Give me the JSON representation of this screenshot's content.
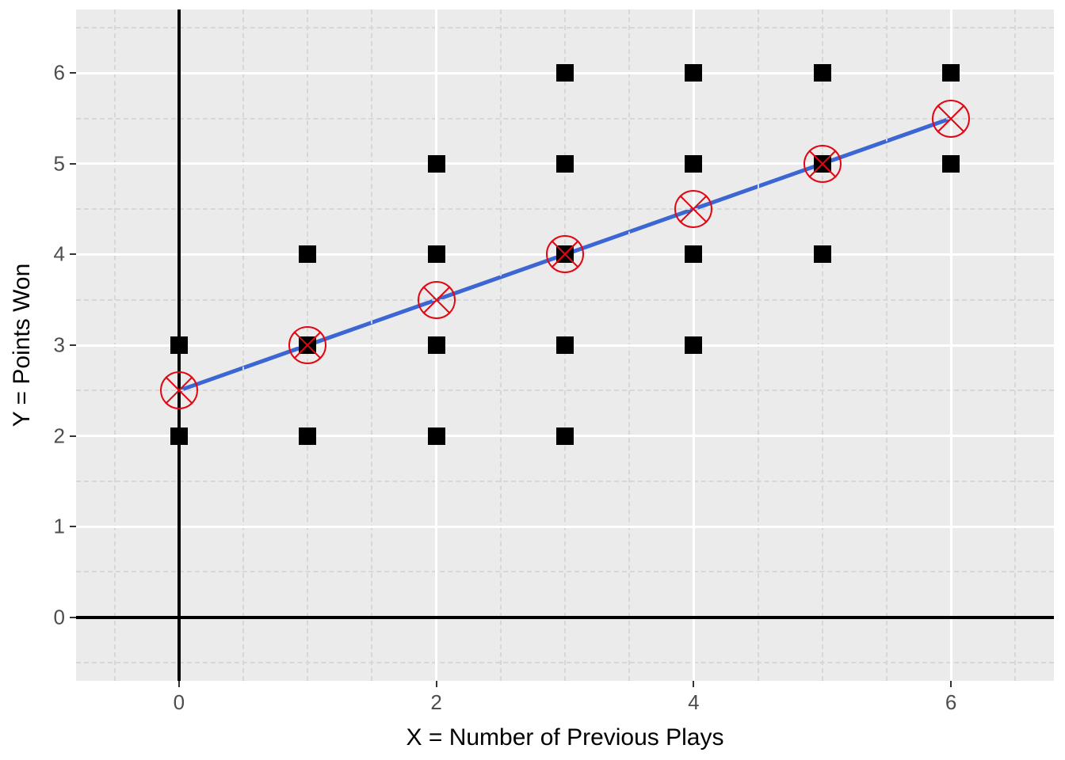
{
  "chart_data": {
    "type": "scatter",
    "xlabel": "X = Number of Previous Plays",
    "ylabel": "Y = Points Won",
    "xlim": [
      -0.8,
      6.8
    ],
    "ylim": [
      -0.7,
      6.7
    ],
    "x_ticks": [
      0,
      2,
      4,
      6
    ],
    "y_ticks": [
      0,
      1,
      2,
      3,
      4,
      5,
      6
    ],
    "x_minor": [
      -0.5,
      0.5,
      1,
      1.5,
      2.5,
      3,
      3.5,
      4.5,
      5,
      5.5,
      6.5
    ],
    "y_minor": [
      -0.5,
      0.5,
      1.5,
      2.5,
      3.5,
      4.5,
      5.5,
      6.5
    ],
    "series": [
      {
        "name": "data-points",
        "marker": "black-square",
        "points": [
          {
            "x": 0,
            "y": 2
          },
          {
            "x": 0,
            "y": 3
          },
          {
            "x": 1,
            "y": 2
          },
          {
            "x": 1,
            "y": 3
          },
          {
            "x": 1,
            "y": 4
          },
          {
            "x": 2,
            "y": 2
          },
          {
            "x": 2,
            "y": 3
          },
          {
            "x": 2,
            "y": 4
          },
          {
            "x": 2,
            "y": 5
          },
          {
            "x": 3,
            "y": 2
          },
          {
            "x": 3,
            "y": 3
          },
          {
            "x": 3,
            "y": 4
          },
          {
            "x": 3,
            "y": 5
          },
          {
            "x": 3,
            "y": 6
          },
          {
            "x": 4,
            "y": 3
          },
          {
            "x": 4,
            "y": 4
          },
          {
            "x": 4,
            "y": 5
          },
          {
            "x": 4,
            "y": 6
          },
          {
            "x": 5,
            "y": 4
          },
          {
            "x": 5,
            "y": 5
          },
          {
            "x": 5,
            "y": 6
          },
          {
            "x": 6,
            "y": 5
          },
          {
            "x": 6,
            "y": 6
          }
        ]
      },
      {
        "name": "conditional-means",
        "marker": "red-circle-x",
        "points": [
          {
            "x": 0,
            "y": 2.5
          },
          {
            "x": 1,
            "y": 3.0
          },
          {
            "x": 2,
            "y": 3.5
          },
          {
            "x": 3,
            "y": 4.0
          },
          {
            "x": 4,
            "y": 4.5
          },
          {
            "x": 5,
            "y": 5.0
          },
          {
            "x": 6,
            "y": 5.5
          }
        ]
      },
      {
        "name": "regression-line",
        "type": "line",
        "color": "#3b66d4",
        "points": [
          {
            "x": 0,
            "y": 2.5
          },
          {
            "x": 6,
            "y": 5.5
          }
        ]
      }
    ],
    "ref_lines": {
      "vline_x": 0,
      "hline_y": 0,
      "color": "#000000"
    },
    "theme": "ggplot2-grey"
  },
  "labels": {
    "xlabel": "X = Number of Previous Plays",
    "ylabel": "Y = Points Won",
    "xt0": "0",
    "xt2": "2",
    "xt4": "4",
    "xt6": "6",
    "yt0": "0",
    "yt1": "1",
    "yt2": "2",
    "yt3": "3",
    "yt4": "4",
    "yt5": "5",
    "yt6": "6"
  },
  "colors": {
    "panel_bg": "#ebebeb",
    "major_grid": "#ffffff",
    "minor_grid": "#d7d7d7",
    "line": "#3b66d4",
    "marker_square": "#000000",
    "marker_circle_x": "#e30613"
  }
}
